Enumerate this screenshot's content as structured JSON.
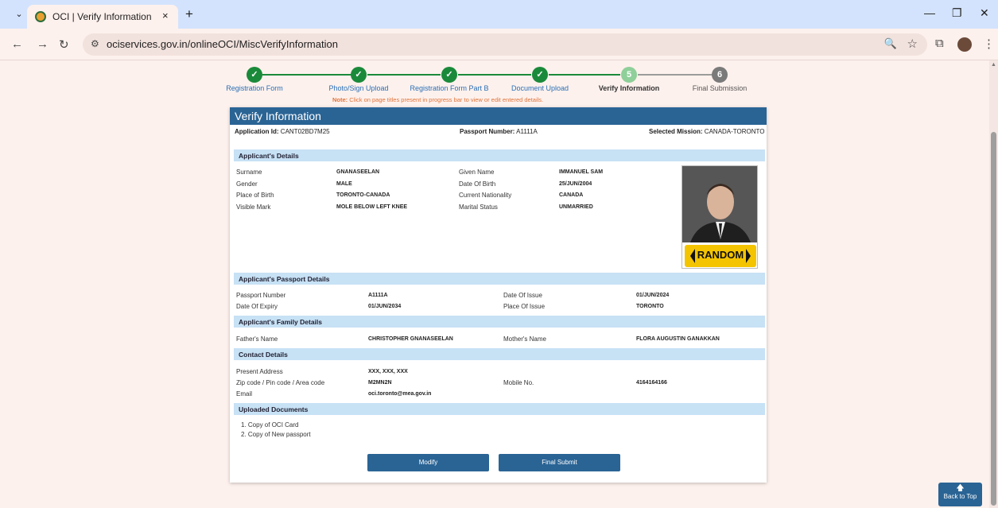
{
  "browser": {
    "tab_title": "OCI | Verify Information",
    "tab_close": "×",
    "new_tab": "+",
    "url": "ociservices.gov.in/onlineOCI/MiscVerifyInformation"
  },
  "progress": {
    "steps": [
      {
        "num": "✓",
        "label": "Registration Form"
      },
      {
        "num": "✓",
        "label": "Photo/Sign Upload"
      },
      {
        "num": "✓",
        "label": "Registration Form Part B"
      },
      {
        "num": "✓",
        "label": "Document Upload"
      },
      {
        "num": "5",
        "label": "Verify Information"
      },
      {
        "num": "6",
        "label": "Final Submission"
      }
    ],
    "note_label": "Note:",
    "note_text": " Click on page titles present in progress bar to view or edit entered details."
  },
  "form": {
    "title": "Verify Information",
    "application_id_label": "Application Id:",
    "application_id": " CANT02BD7M25",
    "passport_number_label": "Passport Number:",
    "passport_number_value": " A1111A",
    "mission_label": "Selected Mission:",
    "mission": " CANADA-TORONTO",
    "applicant_details": {
      "heading": "Applicant's Details",
      "surname_label": "Surname",
      "surname": "GNANASEELAN",
      "given_name_label": "Given Name",
      "given_name": "IMMANUEL SAM",
      "gender_label": "Gender",
      "gender": "MALE",
      "dob_label": "Date Of Birth",
      "dob": "25/JUN/2004",
      "pob_label": "Place of Birth",
      "pob": "TORONTO-CANADA",
      "nationality_label": "Current Nationality",
      "nationality": "CANADA",
      "visible_mark_label": "Visible Mark",
      "visible_mark": "MOLE BELOW LEFT KNEE",
      "marital_label": "Marital Status",
      "marital": "UNMARRIED",
      "photo_sign_text": "RANDOM"
    },
    "passport_details": {
      "heading": "Applicant's Passport Details",
      "passport_no_label": "Passport Number",
      "passport_no": "A1111A",
      "issue_label": "Date Of Issue",
      "issue": "01/JUN/2024",
      "expiry_label": "Date Of Expiry",
      "expiry": "01/JUN/2034",
      "place_label": "Place Of Issue",
      "place": "TORONTO"
    },
    "family_details": {
      "heading": "Applicant's Family Details",
      "father_label": "Father's Name",
      "father": "CHRISTOPHER GNANASEELAN",
      "mother_label": "Mother's Name",
      "mother": "FLORA AUGUSTIN GANAKKAN"
    },
    "contact_details": {
      "heading": "Contact Details",
      "address_label": "Present Address",
      "address": "XXX, XXX, XXX",
      "zip_label": "Zip code / Pin code / Area code",
      "zip": "M2MN2N",
      "mobile_label": "Mobile No.",
      "mobile": "4164164166",
      "email_label": "Email",
      "email": "oci.toronto@mea.gov.in"
    },
    "uploaded": {
      "heading": "Uploaded Documents",
      "doc1": "1. Copy of OCI Card",
      "doc2": "2. Copy of New passport"
    },
    "modify_label": "Modify",
    "submit_label": "Final Submit"
  },
  "back_to_top": "Back to Top",
  "colors": {
    "accent": "#2a6495",
    "done": "#1a8a3a",
    "current": "#8fcf9a",
    "pending": "#7a7a7a",
    "note": "#e0743a"
  }
}
